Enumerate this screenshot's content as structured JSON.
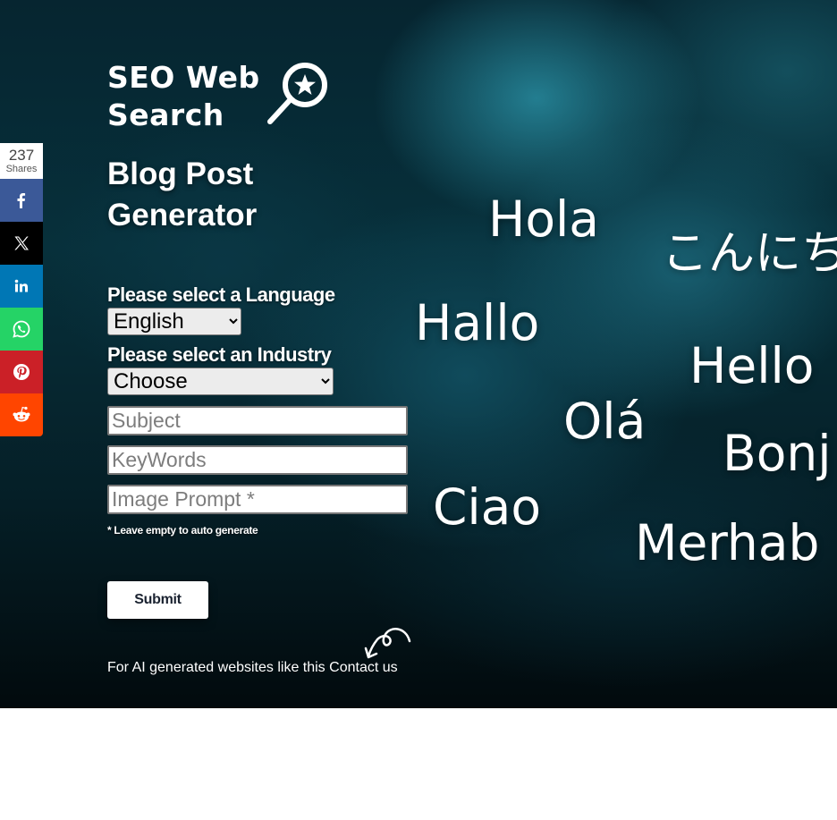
{
  "logo": {
    "line1": "SEO Web",
    "line2": "Search",
    "icon": "magnifier-star-icon"
  },
  "page_title": {
    "line1": "Blog Post",
    "line2": "Generator"
  },
  "form": {
    "language_label": "Please select a Language",
    "language_selected": "English",
    "industry_label": "Please select an Industry",
    "industry_selected": "Choose",
    "subject_placeholder": "Subject",
    "keywords_placeholder": "KeyWords",
    "image_prompt_placeholder": "Image Prompt *",
    "note": "* Leave empty to auto generate",
    "submit_label": "Submit"
  },
  "footer": {
    "text": "For AI generated websites like this",
    "link_label": "Contact us",
    "arrow_icon": "curved-arrow-icon"
  },
  "greetings": {
    "hola": "Hola",
    "konnichiwa": "こんにち",
    "hallo": "Hallo",
    "hello": "Hello",
    "ola": "Olá",
    "bonjour": "Bonj",
    "ciao": "Ciao",
    "merhaba": "Merhab"
  },
  "share_bar": {
    "count": "237",
    "count_label": "Shares",
    "buttons": [
      {
        "name": "facebook",
        "icon": "facebook-icon",
        "color": "#3b5998"
      },
      {
        "name": "x",
        "icon": "x-icon",
        "color": "#000000"
      },
      {
        "name": "linkedin",
        "icon": "linkedin-icon",
        "color": "#0077b5"
      },
      {
        "name": "whatsapp",
        "icon": "whatsapp-icon",
        "color": "#25d366"
      },
      {
        "name": "pinterest",
        "icon": "pinterest-icon",
        "color": "#cb2027"
      },
      {
        "name": "reddit",
        "icon": "reddit-icon",
        "color": "#ff4500"
      }
    ]
  },
  "colors": {
    "hero_dark": "#051f27",
    "hero_teal": "#288ca0",
    "submit_text": "#1a2230"
  }
}
